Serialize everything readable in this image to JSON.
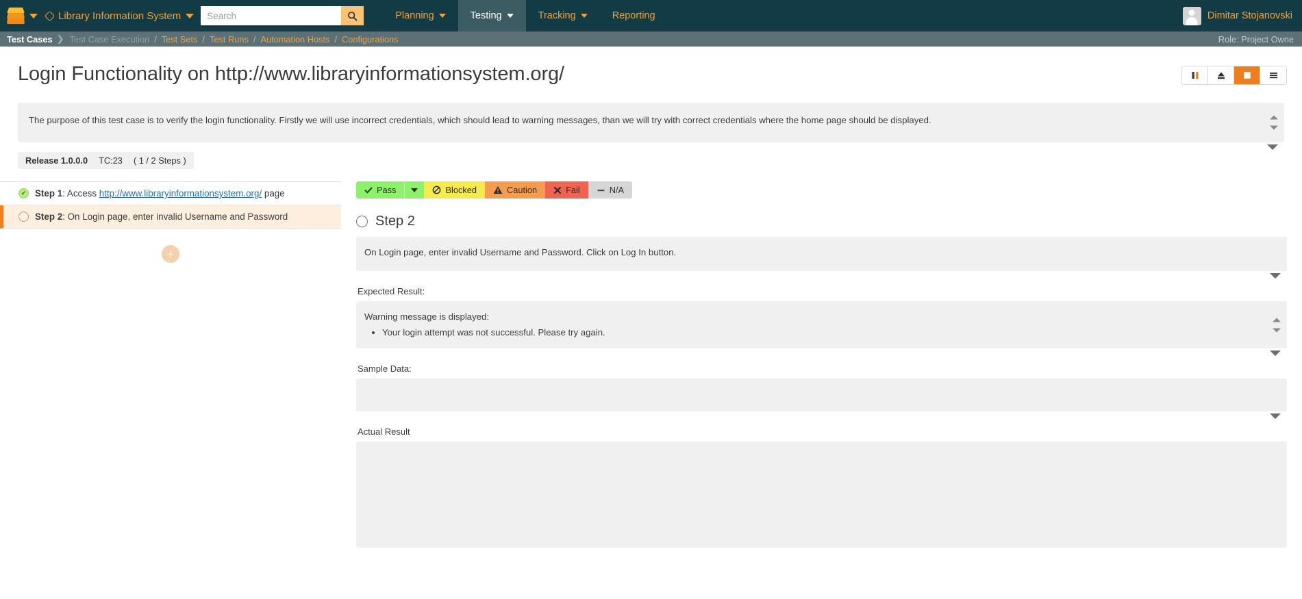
{
  "header": {
    "project_name": "Library Information System",
    "search": {
      "value": "",
      "placeholder": "Search"
    },
    "nav": [
      {
        "label": "Planning",
        "has_caret": true,
        "active": false
      },
      {
        "label": "Testing",
        "has_caret": true,
        "active": true
      },
      {
        "label": "Tracking",
        "has_caret": true,
        "active": false
      },
      {
        "label": "Reporting",
        "has_caret": false,
        "active": false
      }
    ],
    "user_name": "Dimitar Stojanovski"
  },
  "breadcrumb": {
    "items": [
      {
        "label": "Test Cases",
        "state": "current"
      },
      {
        "label": "Test Case Execution",
        "state": "dim"
      },
      {
        "label": "Test Sets",
        "state": "link"
      },
      {
        "label": "Test Runs",
        "state": "link"
      },
      {
        "label": "Automation Hosts",
        "state": "link"
      },
      {
        "label": "Configurations",
        "state": "link"
      }
    ],
    "separator": "/",
    "arrow": "❯",
    "role": "Role: Project Owne"
  },
  "page": {
    "title": "Login Functionality on http://www.libraryinformationsystem.org/",
    "description": "The purpose of this test case is to verify the login functionality. Firstly we will use incorrect credentials, which should lead to warning messages, than we will try with correct credentials where the home page should be displayed.",
    "meta": {
      "release": "Release 1.0.0.0",
      "test_case_id": "TC:23",
      "steps_progress": "( 1 / 2 Steps )"
    },
    "toolbar": [
      {
        "name": "pause-button",
        "icon": "pause-icon",
        "active": false
      },
      {
        "name": "eject-button",
        "icon": "eject-icon",
        "active": false
      },
      {
        "name": "stop-button",
        "icon": "stop-icon",
        "active": true
      },
      {
        "name": "menu-button",
        "icon": "hamburger-icon",
        "active": false
      }
    ]
  },
  "steps": [
    {
      "status": "done",
      "prefix": "Step 1",
      "sep": ": ",
      "text_before": "Access ",
      "link": "http://www.libraryinformationsystem.org/",
      "text_after": " page",
      "selected": false
    },
    {
      "status": "pending",
      "prefix": "Step 2",
      "sep": ": ",
      "text_before": "On Login page, enter invalid Username and Password",
      "link": "",
      "text_after": "",
      "selected": true
    }
  ],
  "add_step_button": "+",
  "status_buttons": [
    {
      "label": "Pass",
      "icon": "check-icon",
      "color": "#8ef06b"
    },
    {
      "label": "Blocked",
      "icon": "blocked-icon",
      "color": "#f6ea4c"
    },
    {
      "label": "Caution",
      "icon": "warning-icon",
      "color": "#f59d4e"
    },
    {
      "label": "Fail",
      "icon": "cross-icon",
      "color": "#ef6352"
    },
    {
      "label": "N/A",
      "icon": "dash-icon",
      "color": "#d6d6d6"
    }
  ],
  "detail": {
    "step_title": "Step 2",
    "description": "On Login page, enter invalid Username and Password. Click on Log In button.",
    "expected_label": "Expected Result:",
    "expected_text": "Warning message is displayed:",
    "expected_bullets": [
      "Your login attempt was not successful. Please try again."
    ],
    "sample_label": "Sample Data:",
    "sample_value": "",
    "actual_label": "Actual Result",
    "actual_value": ""
  }
}
